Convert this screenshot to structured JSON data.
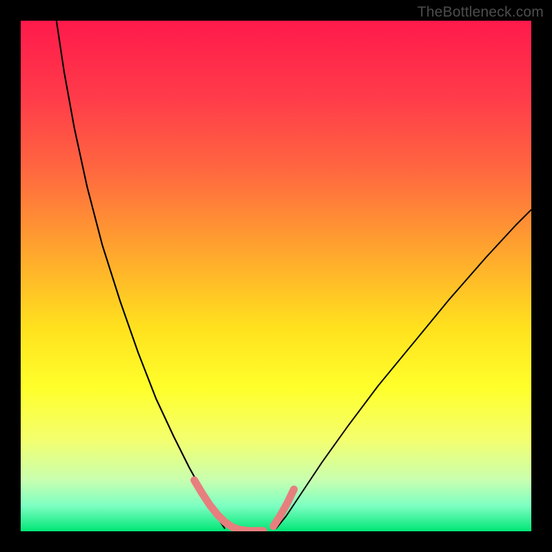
{
  "watermark": "TheBottleneck.com",
  "chart_data": {
    "type": "line",
    "title": "",
    "xlabel": "",
    "ylabel": "",
    "xlim": [
      0,
      100
    ],
    "ylim": [
      0,
      100
    ],
    "grid": false,
    "legend": false,
    "gradient_stops": [
      {
        "pos": 0.0,
        "color": "#ff1a4b"
      },
      {
        "pos": 0.15,
        "color": "#ff3b4a"
      },
      {
        "pos": 0.3,
        "color": "#ff6a3f"
      },
      {
        "pos": 0.45,
        "color": "#ffa52e"
      },
      {
        "pos": 0.6,
        "color": "#ffe11e"
      },
      {
        "pos": 0.72,
        "color": "#ffff2b"
      },
      {
        "pos": 0.82,
        "color": "#f4ff6e"
      },
      {
        "pos": 0.9,
        "color": "#c8ffb0"
      },
      {
        "pos": 0.95,
        "color": "#7dffc2"
      },
      {
        "pos": 1.0,
        "color": "#00e676"
      }
    ],
    "series": [
      {
        "name": "left-branch",
        "color": "#000000",
        "width": 2.2,
        "x": [
          7.0,
          8.5,
          10.5,
          13.0,
          16.0,
          19.5,
          23.0,
          26.5,
          30.0,
          33.0,
          35.5,
          37.5,
          39.0,
          40.0
        ],
        "y": [
          100.0,
          90.0,
          79.0,
          67.5,
          56.0,
          45.0,
          35.0,
          26.0,
          18.5,
          12.5,
          8.0,
          4.5,
          2.0,
          0.5
        ]
      },
      {
        "name": "right-branch",
        "color": "#000000",
        "width": 2.0,
        "x": [
          50.0,
          52.0,
          55.0,
          59.0,
          64.0,
          70.0,
          77.0,
          84.0,
          91.0,
          97.0,
          100.0
        ],
        "y": [
          0.5,
          3.0,
          7.5,
          13.5,
          20.5,
          28.5,
          37.0,
          45.5,
          53.5,
          60.0,
          63.0
        ]
      },
      {
        "name": "left-marker-cluster",
        "color": "#e77f7e",
        "width": 11,
        "linecap": "round",
        "x": [
          34.0,
          35.5,
          37.0,
          38.5,
          40.0,
          41.5,
          43.0,
          44.5,
          46.0,
          47.5
        ],
        "y": [
          10.0,
          7.5,
          5.2,
          3.3,
          1.8,
          0.8,
          0.3,
          0.1,
          0.1,
          0.1
        ]
      },
      {
        "name": "right-marker-cluster",
        "color": "#e77f7e",
        "width": 11,
        "linecap": "round",
        "x": [
          49.5,
          50.8,
          52.2,
          53.5
        ],
        "y": [
          1.0,
          3.0,
          5.5,
          8.2
        ]
      }
    ]
  }
}
